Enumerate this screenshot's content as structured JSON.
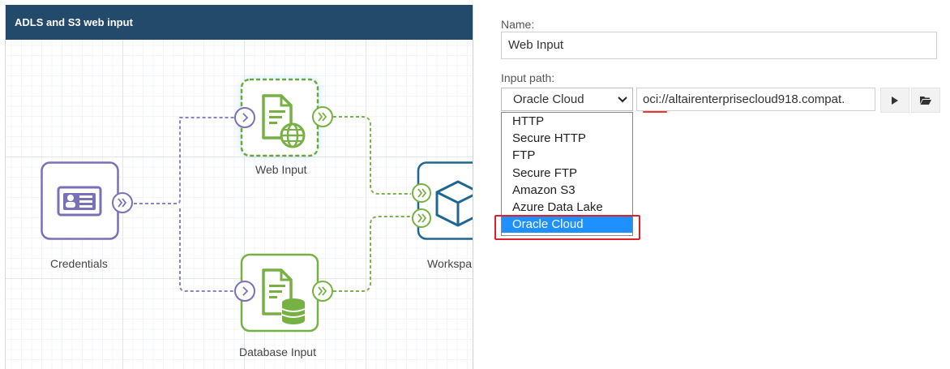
{
  "canvas": {
    "title": "ADLS and S3 web input",
    "nodes": {
      "credentials": {
        "label": "Credentials"
      },
      "web_input": {
        "label": "Web Input"
      },
      "database_input": {
        "label": "Database Input"
      },
      "workspace": {
        "label": "Workspa"
      }
    },
    "colors": {
      "credentials": "#7a70b8",
      "input_node": "#77b043",
      "workspace": "#1f6791",
      "wire_purple": "#8c84c6",
      "wire_green": "#7fb24c",
      "header": "#23496b"
    }
  },
  "properties": {
    "name_label": "Name:",
    "name_value": "Web Input",
    "path_label": "Input path:",
    "path_protocol": "Oracle Cloud",
    "path_value": "oci://altairenterprisecloud918.compat.",
    "run_icon": "play-icon",
    "browse_icon": "folder-open-icon",
    "protocol_options": [
      "HTTP",
      "Secure HTTP",
      "FTP",
      "Secure FTP",
      "Amazon S3",
      "Azure Data Lake",
      "Oracle Cloud"
    ],
    "selected_option": "Oracle Cloud",
    "colors": {
      "selected_bg": "#1e90ff",
      "highlight": "#e0202b"
    }
  }
}
